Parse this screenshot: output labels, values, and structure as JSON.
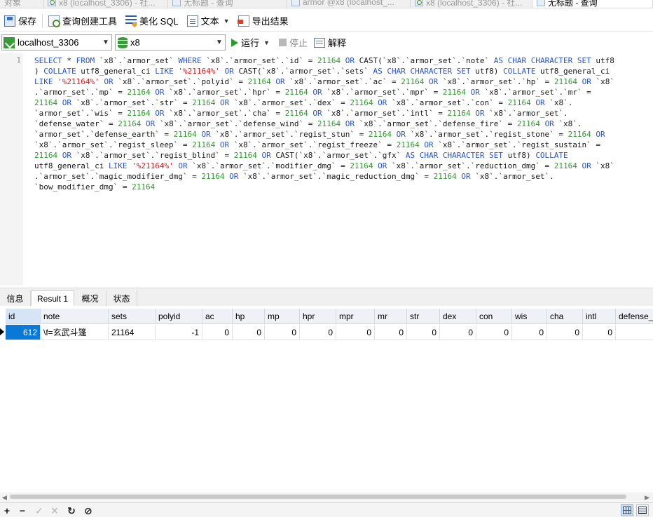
{
  "tabs": [
    {
      "label": "对象",
      "icon": "none"
    },
    {
      "label": "x8 (localhost_3306) - 社...",
      "icon": "query-icon"
    },
    {
      "label": "无标题 - 查询",
      "icon": "table-icon"
    },
    {
      "label": "armor @x8 (localhost_...",
      "icon": "table-icon"
    },
    {
      "label": "x8 (localhost_3306) - 社...",
      "icon": "query-icon"
    },
    {
      "label": "无标题 - 查询",
      "icon": "table-icon"
    }
  ],
  "toolbar": {
    "save": "保存",
    "query_builder": "查询创建工具",
    "beautify": "美化 SQL",
    "text": "文本",
    "export": "导出结果"
  },
  "connection": {
    "server": "localhost_3306",
    "database": "x8",
    "run": "运行",
    "stop": "停止",
    "explain": "解释"
  },
  "editor": {
    "line_number": "1",
    "lines": [
      [
        [
          "kw",
          "SELECT "
        ],
        [
          "op",
          "* "
        ],
        [
          "kw",
          "FROM "
        ],
        [
          "op",
          "`x8`.`armor_set` "
        ],
        [
          "kw",
          "WHERE "
        ],
        [
          "op",
          "`x8`.`armor_set`.`id` = "
        ],
        [
          "num",
          "21164 "
        ],
        [
          "kw",
          "OR "
        ],
        [
          "op",
          "CAST(`x8`.`armor_set`.`note` "
        ],
        [
          "kw",
          "AS CHAR CHARACTER SET "
        ],
        [
          "op",
          "utf8"
        ]
      ],
      [
        [
          "op",
          ") "
        ],
        [
          "kw",
          "COLLATE "
        ],
        [
          "op",
          "utf8_general_ci "
        ],
        [
          "kw",
          "LIKE "
        ],
        [
          "str",
          "'%21164%' "
        ],
        [
          "kw",
          "OR "
        ],
        [
          "op",
          "CAST(`x8`.`armor_set`.`sets` "
        ],
        [
          "kw",
          "AS CHAR CHARACTER SET "
        ],
        [
          "op",
          "utf8) "
        ],
        [
          "kw",
          "COLLATE "
        ],
        [
          "op",
          "utf8_general_ci"
        ]
      ],
      [
        [
          "kw",
          "LIKE "
        ],
        [
          "str",
          "'%21164%' "
        ],
        [
          "kw",
          "OR "
        ],
        [
          "op",
          "`x8`.`armor_set`.`polyid` = "
        ],
        [
          "num",
          "21164 "
        ],
        [
          "kw",
          "OR "
        ],
        [
          "op",
          "`x8`.`armor_set`.`ac` = "
        ],
        [
          "num",
          "21164 "
        ],
        [
          "kw",
          "OR "
        ],
        [
          "op",
          "`x8`.`armor_set`.`hp` = "
        ],
        [
          "num",
          "21164 "
        ],
        [
          "kw",
          "OR "
        ],
        [
          "op",
          "`x8`"
        ]
      ],
      [
        [
          "op",
          ".`armor_set`.`mp` = "
        ],
        [
          "num",
          "21164 "
        ],
        [
          "kw",
          "OR "
        ],
        [
          "op",
          "`x8`.`armor_set`.`hpr` = "
        ],
        [
          "num",
          "21164 "
        ],
        [
          "kw",
          "OR "
        ],
        [
          "op",
          "`x8`.`armor_set`.`mpr` = "
        ],
        [
          "num",
          "21164 "
        ],
        [
          "kw",
          "OR "
        ],
        [
          "op",
          "`x8`.`armor_set`.`mr` ="
        ]
      ],
      [
        [
          "num",
          "21164 "
        ],
        [
          "kw",
          "OR "
        ],
        [
          "op",
          "`x8`.`armor_set`.`str` = "
        ],
        [
          "num",
          "21164 "
        ],
        [
          "kw",
          "OR "
        ],
        [
          "op",
          "`x8`.`armor_set`.`dex` = "
        ],
        [
          "num",
          "21164 "
        ],
        [
          "kw",
          "OR "
        ],
        [
          "op",
          "`x8`.`armor_set`.`con` = "
        ],
        [
          "num",
          "21164 "
        ],
        [
          "kw",
          "OR "
        ],
        [
          "op",
          "`x8`."
        ]
      ],
      [
        [
          "op",
          "`armor_set`.`wis` = "
        ],
        [
          "num",
          "21164 "
        ],
        [
          "kw",
          "OR "
        ],
        [
          "op",
          "`x8`.`armor_set`.`cha` = "
        ],
        [
          "num",
          "21164 "
        ],
        [
          "kw",
          "OR "
        ],
        [
          "op",
          "`x8`.`armor_set`.`intl` = "
        ],
        [
          "num",
          "21164 "
        ],
        [
          "kw",
          "OR "
        ],
        [
          "op",
          "`x8`.`armor_set`."
        ]
      ],
      [
        [
          "op",
          "`defense_water` = "
        ],
        [
          "num",
          "21164 "
        ],
        [
          "kw",
          "OR "
        ],
        [
          "op",
          "`x8`.`armor_set`.`defense_wind` = "
        ],
        [
          "num",
          "21164 "
        ],
        [
          "kw",
          "OR "
        ],
        [
          "op",
          "`x8`.`armor_set`.`defense_fire` = "
        ],
        [
          "num",
          "21164 "
        ],
        [
          "kw",
          "OR "
        ],
        [
          "op",
          "`x8`."
        ]
      ],
      [
        [
          "op",
          "`armor_set`.`defense_earth` = "
        ],
        [
          "num",
          "21164 "
        ],
        [
          "kw",
          "OR "
        ],
        [
          "op",
          "`x8`.`armor_set`.`regist_stun` = "
        ],
        [
          "num",
          "21164 "
        ],
        [
          "kw",
          "OR "
        ],
        [
          "op",
          "`x8`.`armor_set`.`regist_stone` = "
        ],
        [
          "num",
          "21164 "
        ],
        [
          "kw",
          "OR"
        ]
      ],
      [
        [
          "op",
          "`x8`.`armor_set`.`regist_sleep` = "
        ],
        [
          "num",
          "21164 "
        ],
        [
          "kw",
          "OR "
        ],
        [
          "op",
          "`x8`.`armor_set`.`regist_freeze` = "
        ],
        [
          "num",
          "21164 "
        ],
        [
          "kw",
          "OR "
        ],
        [
          "op",
          "`x8`.`armor_set`.`regist_sustain` ="
        ]
      ],
      [
        [
          "num",
          "21164 "
        ],
        [
          "kw",
          "OR "
        ],
        [
          "op",
          "`x8`.`armor_set`.`regist_blind` = "
        ],
        [
          "num",
          "21164 "
        ],
        [
          "kw",
          "OR "
        ],
        [
          "op",
          "CAST(`x8`.`armor_set`.`gfx` "
        ],
        [
          "kw",
          "AS CHAR CHARACTER SET "
        ],
        [
          "op",
          "utf8) "
        ],
        [
          "kw",
          "COLLATE"
        ]
      ],
      [
        [
          "op",
          "utf8_general_ci "
        ],
        [
          "kw",
          "LIKE "
        ],
        [
          "str",
          "'%21164%' "
        ],
        [
          "kw",
          "OR "
        ],
        [
          "op",
          "`x8`.`armor_set`.`modifier_dmg` = "
        ],
        [
          "num",
          "21164 "
        ],
        [
          "kw",
          "OR "
        ],
        [
          "op",
          "`x8`.`armor_set`.`reduction_dmg` = "
        ],
        [
          "num",
          "21164 "
        ],
        [
          "kw",
          "OR "
        ],
        [
          "op",
          "`x8`"
        ]
      ],
      [
        [
          "op",
          ".`armor_set`.`magic_modifier_dmg` = "
        ],
        [
          "num",
          "21164 "
        ],
        [
          "kw",
          "OR "
        ],
        [
          "op",
          "`x8`.`armor_set`.`magic_reduction_dmg` = "
        ],
        [
          "num",
          "21164 "
        ],
        [
          "kw",
          "OR "
        ],
        [
          "op",
          "`x8`.`armor_set`."
        ]
      ],
      [
        [
          "op",
          "`bow_modifier_dmg` = "
        ],
        [
          "num",
          "21164"
        ]
      ]
    ]
  },
  "result_tabs": [
    "信息",
    "Result 1",
    "概况",
    "状态"
  ],
  "grid": {
    "columns": [
      "id",
      "note",
      "sets",
      "polyid",
      "ac",
      "hp",
      "mp",
      "hpr",
      "mpr",
      "mr",
      "str",
      "dex",
      "con",
      "wis",
      "cha",
      "intl",
      "defense_"
    ],
    "rows": [
      [
        "612",
        "\\f=玄武斗篷",
        "21164",
        "-1",
        "0",
        "0",
        "0",
        "0",
        "0",
        "0",
        "0",
        "0",
        "0",
        "0",
        "0",
        "0",
        ""
      ]
    ]
  },
  "colors": {
    "keyword": "#2b55c9",
    "number": "#2e9a2e",
    "string": "#d02020",
    "selection": "#0a78d7"
  }
}
